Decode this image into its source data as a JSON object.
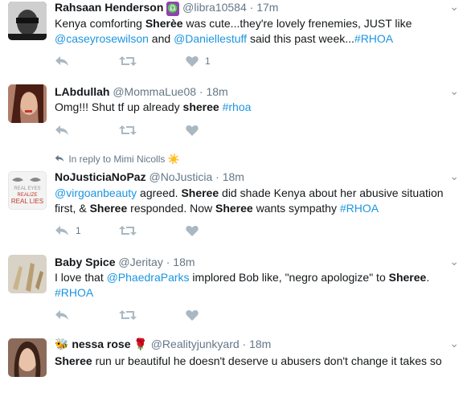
{
  "tweets": [
    {
      "fullname": "Rahsaan Henderson",
      "emoji_after_name": "♎",
      "handle": "@libra10584",
      "dot": "·",
      "time": "17m",
      "text_parts": [
        "Kenya comforting ",
        "Sherèe",
        " was cute...they're lovely frenemies, JUST like "
      ],
      "line2_parts": [
        "@caseyrosewilson",
        " and ",
        "@Daniellestuff",
        " said this past week...",
        "#RHOA"
      ],
      "like_count": "1"
    },
    {
      "fullname": "LAbdullah",
      "handle": "@MommaLue08",
      "dot": "·",
      "time": "18m",
      "text_parts": [
        "Omg!!! Shut tf up already ",
        "sheree",
        " ",
        "#rhoa"
      ]
    },
    {
      "reply_context": "In reply to Mimi Nicolls",
      "reply_emoji": "☀️",
      "fullname": "NoJusticiaNoPaz",
      "handle": "@NoJusticia",
      "dot": "·",
      "time": "18m",
      "line1_parts": [
        "@virgoanbeauty",
        " agreed. ",
        "Sheree",
        " did shade Kenya about her abusive situation"
      ],
      "line2_parts": [
        "first, & ",
        "Sheree",
        " responded. Now ",
        "Sheree",
        " wants sympathy ",
        "#RHOA"
      ],
      "reply_count": "1",
      "avatar_lines": [
        "REAL EYES",
        "REALIZE",
        "REAL LIES"
      ]
    },
    {
      "fullname": "Baby Spice",
      "handle": "@Jeritay",
      "dot": "·",
      "time": "18m",
      "line1_parts": [
        "I love that ",
        "@PhaedraParks",
        " implored Bob like, \"negro apologize\" to ",
        "Sheree",
        "."
      ],
      "line2_parts": [
        "#RHOA"
      ]
    },
    {
      "emoji_before_name": "🐝",
      "fullname": "nessa rose",
      "emoji_after_name": "🌹",
      "handle": "@Realityjunkyard",
      "dot": "·",
      "time": "18m",
      "line1_parts": [
        "Sheree",
        " run ur beautiful he doesn't deserve u abusers don't change it takes so"
      ]
    }
  ],
  "icons": {
    "reply": "reply-icon",
    "retweet": "retweet-icon",
    "like": "heart-icon",
    "more": "chevron-down-icon"
  },
  "colors": {
    "link": "#1b95e0",
    "muted": "#657786",
    "icon": "#aab8c2",
    "divider": "#e1e8ed"
  }
}
